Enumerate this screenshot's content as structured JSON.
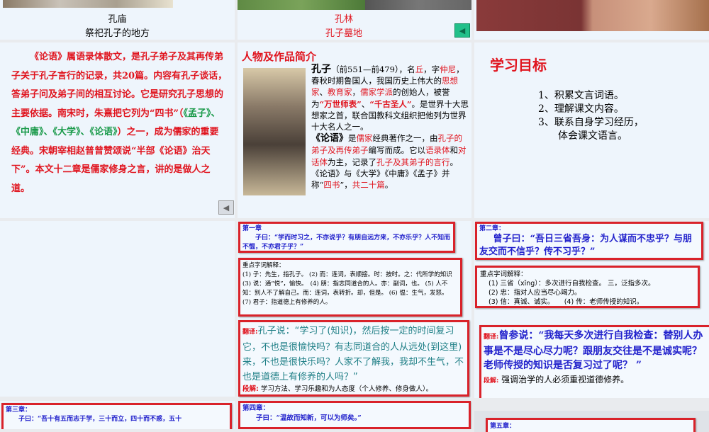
{
  "slides": {
    "s1": {
      "caption1": "孔庙",
      "caption2": "祭祀孔子的地方"
    },
    "s2": {
      "caption1": "孔林",
      "caption2": "孔子墓地"
    },
    "s4": {
      "p": [
        "《论语》属语录体散文，是孔子弟子及其再传弟子关于孔子言行的记录，共20篇。内容有孔子谈话，答弟子问及弟子间的相互讨论。它是研究孔子思想的主要依据。南宋时，朱熹把它列为“四书”（",
        "《孟子》、《中庸》、《大学》、《论语》",
        "）之一，成为儒家的重要经典。宋朝宰相赵普曾赞颂说“半部《论语》治天下”。本文十二章是儒家修身之言，讲的是做人之道。"
      ]
    },
    "s5": {
      "title": "人物及作品简介",
      "name": "孔子",
      "t1": "（前551—前479），名",
      "qiu": "丘",
      "t2": "，字",
      "zhongni": "仲尼",
      "t3": "，春秋时期鲁国人，我国历史上伟大的",
      "sxj": "思想家",
      "t4": "、",
      "jyj": "教育家",
      "t5": "，",
      "rjxp": "儒家学派",
      "t6": "的创始人，被誉为",
      "wssb": "“万世师表”",
      "t7": "、",
      "qgsr": "“千古圣人”",
      "t8": "。是世界十大思想家之首，联合国教科文组织把他列为世界十大名人之一。",
      "lunyu": "《论语》",
      "u1": "是",
      "rj": "儒家",
      "u2": "经典著作之一，由",
      "dz": "孔子的弟子及再传弟子",
      "u3": "编写而成。它以",
      "ylt": "语录体",
      "u4": "和",
      "dht": "对话体",
      "u5": "为主，记录了",
      "yx": "孔子及其弟子的言行",
      "u6": "。《论语》与《大学》《中庸》《孟子》并称“",
      "ss": "四书",
      "u7": "”，",
      "eshp": "共二十篇",
      "u8": "。"
    },
    "s6": {
      "title": "学习目标",
      "items": [
        "1、积累文言词语。",
        "2、理解课文内容。",
        "3、联系自身学习经历，",
        "体会课文语言。"
      ]
    },
    "s8": {
      "chapter": "第一章",
      "quote": "子曰：“学而时习之，不亦说乎？有朋自远方来，不亦乐乎？人不知而不愠，不亦君子乎？”",
      "notes_title": "重点字词解释：",
      "notes": "(1) 子：先生，指孔子。 (2) 而：连词，表顺接。时：按时。之：代所学的知识　(3) 说：通“悦”，愉快。　(4) 朋：指志同道合的人。亦：副词，也。 (5) 人不知：别人不了解自己。而：连词，表转折。却，但是。 (6) 愠：生气，发怒。 (7) 君子：指道德上有修养的人。",
      "trans_label": "翻译:",
      "trans": "孔子说：“学习了(知识)，然后按一定的时间复习它，不也是很愉快吗？有志同道合的人从远处(到这里)来，不也是很快乐吗？人家不了解我，我却不生气，不也是道德上有修养的人吗？”",
      "dj_label": "段解:",
      "dj": "学习方法、学习乐趣和为人态度（个人修养、修身做人）。"
    },
    "s9": {
      "chapter": "第二章：",
      "quote": "曾子曰：“吾日三省吾身：为人谋而不忠乎？与朋友交而不信乎？传不习乎？”",
      "notes_title": "重点字词解释：",
      "notes": [
        "(1) 三省（xǐng）：多次进行自我检查。 三，泛指多次。",
        "(2) 忠：指对人应当尽心竭力。",
        "(3) 信：真诚、诚实。　　(4) 传：老师传授的知识。"
      ],
      "trans_label": "翻译:",
      "trans": "曾参说：“我每天多次进行自我检查：替别人办事是不是尽心尽力呢？跟朋友交往是不是诚实呢？老师传授的知识是否复习过了呢？ ”",
      "dj_label": "段解:",
      "dj": "强调治学的人必须重视道德修养。"
    },
    "s10": {
      "chapter": "第三章：",
      "quote": "子曰：“吾十有五而志于学，三十而立，四十而不惑，五十"
    },
    "s11": {
      "chapter": "第四章：",
      "quote": "子曰：“温故而知新，可以为师矣。”"
    },
    "s12": {
      "chapter": "第五章："
    }
  }
}
